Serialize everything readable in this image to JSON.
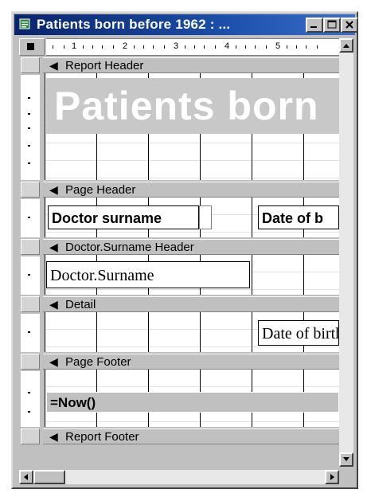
{
  "window": {
    "title": "Patients born before 1962 : ..."
  },
  "ruler": {
    "labels": [
      "1",
      "2",
      "3",
      "4",
      "5"
    ]
  },
  "sections": {
    "report_header": "Report Header",
    "page_header": "Page Header",
    "group_header": "Doctor.Surname Header",
    "detail": "Detail",
    "page_footer": "Page Footer",
    "report_footer": "Report Footer"
  },
  "report_header": {
    "title_text": "Patients born"
  },
  "page_header": {
    "label_doctor_surname": "Doctor surname",
    "label_date_of_birth": "Date of b"
  },
  "group_header": {
    "field_doctor_surname": "Doctor.Surname"
  },
  "detail": {
    "field_date_of_birth": "Date of birth"
  },
  "page_footer": {
    "formula": "=Now()"
  },
  "icons": [
    "report-icon",
    "minimize-icon",
    "maximize-icon",
    "close-icon",
    "ruler-corner-icon",
    "section-arrow-icon",
    "scroll-up-icon",
    "scroll-down-icon",
    "scroll-left-icon",
    "scroll-right-icon"
  ]
}
